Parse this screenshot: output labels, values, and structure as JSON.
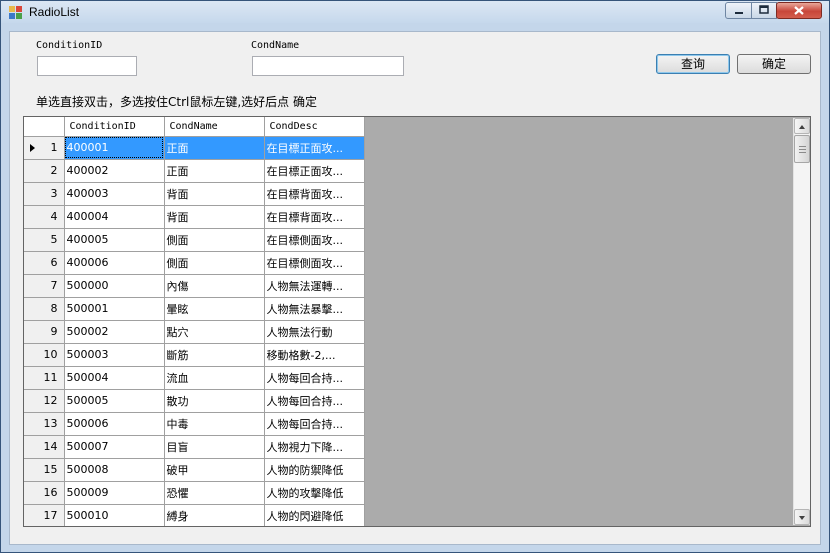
{
  "window": {
    "title": "RadioList"
  },
  "filters": {
    "condition_id_label": "ConditionID",
    "condition_id_value": "",
    "cond_name_label": "CondName",
    "cond_name_value": ""
  },
  "buttons": {
    "query": "查询",
    "confirm": "确定"
  },
  "hint": "单选直接双击，多选按住Ctrl鼠标左键,选好后点 确定",
  "grid": {
    "columns": [
      "ConditionID",
      "CondName",
      "CondDesc"
    ],
    "selected_row": 1,
    "rows": [
      {
        "n": "1",
        "id": "400001",
        "name": "正面",
        "desc": "在目標正面攻..."
      },
      {
        "n": "2",
        "id": "400002",
        "name": "正面",
        "desc": "在目標正面攻..."
      },
      {
        "n": "3",
        "id": "400003",
        "name": "背面",
        "desc": "在目標背面攻..."
      },
      {
        "n": "4",
        "id": "400004",
        "name": "背面",
        "desc": "在目標背面攻..."
      },
      {
        "n": "5",
        "id": "400005",
        "name": "側面",
        "desc": "在目標側面攻..."
      },
      {
        "n": "6",
        "id": "400006",
        "name": "側面",
        "desc": "在目標側面攻..."
      },
      {
        "n": "7",
        "id": "500000",
        "name": "內傷",
        "desc": "人物無法運轉..."
      },
      {
        "n": "8",
        "id": "500001",
        "name": "暈眩",
        "desc": "人物無法暴擊..."
      },
      {
        "n": "9",
        "id": "500002",
        "name": "點穴",
        "desc": "人物無法行動"
      },
      {
        "n": "10",
        "id": "500003",
        "name": "斷筋",
        "desc": "移動格數-2,..."
      },
      {
        "n": "11",
        "id": "500004",
        "name": "流血",
        "desc": "人物每回合持..."
      },
      {
        "n": "12",
        "id": "500005",
        "name": "散功",
        "desc": "人物每回合持..."
      },
      {
        "n": "13",
        "id": "500006",
        "name": "中毒",
        "desc": "人物每回合持..."
      },
      {
        "n": "14",
        "id": "500007",
        "name": "目盲",
        "desc": "人物視力下降..."
      },
      {
        "n": "15",
        "id": "500008",
        "name": "破甲",
        "desc": "人物的防禦降低"
      },
      {
        "n": "16",
        "id": "500009",
        "name": "恐懼",
        "desc": "人物的攻擊降低"
      },
      {
        "n": "17",
        "id": "500010",
        "name": "縛身",
        "desc": "人物的閃避降低"
      }
    ]
  },
  "icons": {
    "app": "app-window-icon",
    "minimize": "minimize-icon",
    "maximize": "maximize-icon",
    "close": "close-icon"
  },
  "colors": {
    "selection": "#3399ff",
    "grid_background": "#ababab",
    "close_button": "#c8463a"
  }
}
